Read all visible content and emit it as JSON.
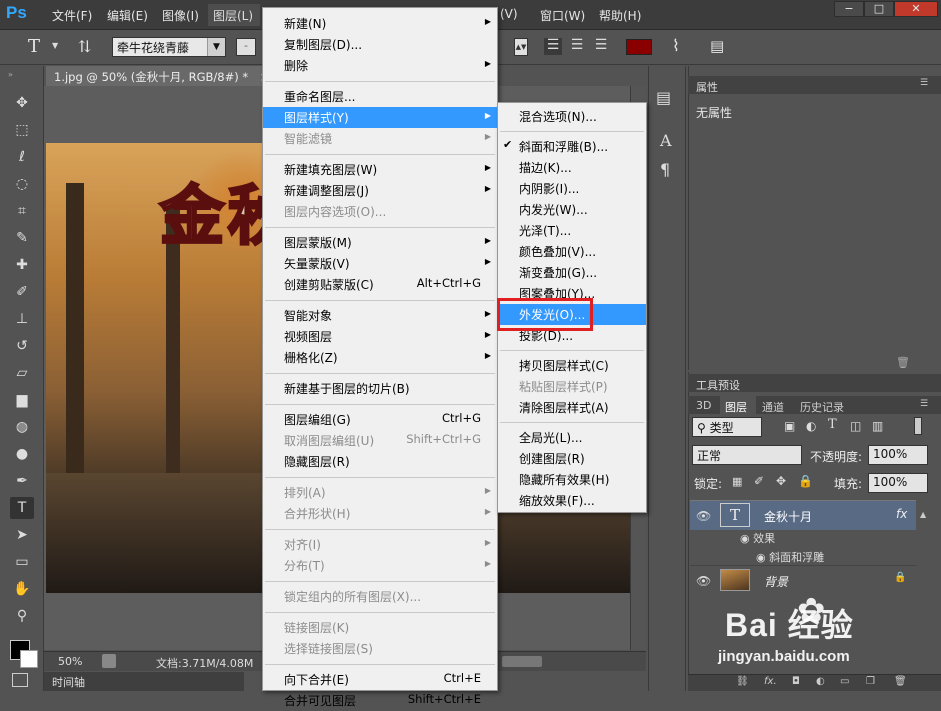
{
  "app": {
    "logo": "Ps"
  },
  "menubar": {
    "items": [
      "文件(F)",
      "编辑(E)",
      "图像(I)",
      "图层(L)",
      "(V)",
      "窗口(W)",
      "帮助(H)"
    ],
    "window_buttons": [
      "−",
      "□",
      "✕"
    ]
  },
  "options": {
    "tool_glyph": "T",
    "font_family": "牵牛花绕青藤",
    "dash": "-",
    "accent_color": "#8a0000"
  },
  "tools": [
    {
      "icon": "move-icon",
      "glyph": "✥"
    },
    {
      "icon": "marquee-icon",
      "glyph": "⬚"
    },
    {
      "icon": "lasso-icon",
      "glyph": "ℓ"
    },
    {
      "icon": "quick-select-icon",
      "glyph": "◌"
    },
    {
      "icon": "crop-icon",
      "glyph": "⌗"
    },
    {
      "icon": "eyedropper-icon",
      "glyph": "✎"
    },
    {
      "icon": "healing-icon",
      "glyph": "✚"
    },
    {
      "icon": "brush-icon",
      "glyph": "✐"
    },
    {
      "icon": "stamp-icon",
      "glyph": "⊥"
    },
    {
      "icon": "history-brush-icon",
      "glyph": "↺"
    },
    {
      "icon": "eraser-icon",
      "glyph": "▱"
    },
    {
      "icon": "gradient-icon",
      "glyph": "▆"
    },
    {
      "icon": "blur-icon",
      "glyph": "◍"
    },
    {
      "icon": "dodge-icon",
      "glyph": "●"
    },
    {
      "icon": "pen-icon",
      "glyph": "✒"
    },
    {
      "icon": "type-icon",
      "glyph": "T"
    },
    {
      "icon": "path-select-icon",
      "glyph": "➤"
    },
    {
      "icon": "rectangle-icon",
      "glyph": "▭"
    },
    {
      "icon": "hand-icon",
      "glyph": "✋"
    },
    {
      "icon": "zoom-icon",
      "glyph": "⚲"
    }
  ],
  "document": {
    "tab_title": "1.jpg @ 50% (金秋十月, RGB/8#) *",
    "tab_close": "×",
    "canvas_text": "金秋",
    "zoom": "50%",
    "doc_size": "文档:3.71M/4.08M"
  },
  "timeline": {
    "label": "时间轴"
  },
  "properties": {
    "title": "属性",
    "body": "无属性"
  },
  "panels": {
    "tool_presets": "工具预设",
    "tabs": [
      "3D",
      "图层",
      "通道",
      "历史记录"
    ]
  },
  "layers": {
    "filter_label": "类型",
    "blend_mode": "正常",
    "opacity_label": "不透明度:",
    "opacity_value": "100%",
    "lock_label": "锁定:",
    "fill_label": "填充:",
    "fill_value": "100%",
    "text_layer": {
      "name": "金秋十月",
      "fx": "fx",
      "thumb": "T"
    },
    "effects_label": "效果",
    "effect_item": "斜面和浮雕",
    "bg_layer": {
      "name": "背景"
    }
  },
  "watermark": {
    "logo": "Bai  经验",
    "url": "jingyan.baidu.com"
  },
  "main_menu": {
    "items": [
      {
        "label": "新建(N)",
        "sub": true
      },
      {
        "label": "复制图层(D)..."
      },
      {
        "label": "删除",
        "sub": true
      },
      {
        "sep": true
      },
      {
        "label": "重命名图层..."
      },
      {
        "label": "图层样式(Y)",
        "sub": true,
        "highlight": true
      },
      {
        "label": "智能滤镜",
        "disabled": true,
        "sub": true
      },
      {
        "sep": true
      },
      {
        "label": "新建填充图层(W)",
        "sub": true
      },
      {
        "label": "新建调整图层(J)",
        "sub": true
      },
      {
        "label": "图层内容选项(O)...",
        "disabled": true
      },
      {
        "sep": true
      },
      {
        "label": "图层蒙版(M)",
        "sub": true
      },
      {
        "label": "矢量蒙版(V)",
        "sub": true
      },
      {
        "label": "创建剪贴蒙版(C)",
        "shortcut": "Alt+Ctrl+G"
      },
      {
        "sep": true
      },
      {
        "label": "智能对象",
        "sub": true
      },
      {
        "label": "视频图层",
        "sub": true
      },
      {
        "label": "栅格化(Z)",
        "sub": true
      },
      {
        "sep": true
      },
      {
        "label": "新建基于图层的切片(B)"
      },
      {
        "sep": true
      },
      {
        "label": "图层编组(G)",
        "shortcut": "Ctrl+G"
      },
      {
        "label": "取消图层编组(U)",
        "shortcut": "Shift+Ctrl+G",
        "disabled": true
      },
      {
        "label": "隐藏图层(R)"
      },
      {
        "sep": true
      },
      {
        "label": "排列(A)",
        "sub": true,
        "disabled": true
      },
      {
        "label": "合并形状(H)",
        "sub": true,
        "disabled": true
      },
      {
        "sep": true
      },
      {
        "label": "对齐(I)",
        "sub": true,
        "disabled": true
      },
      {
        "label": "分布(T)",
        "sub": true,
        "disabled": true
      },
      {
        "sep": true
      },
      {
        "label": "锁定组内的所有图层(X)...",
        "disabled": true
      },
      {
        "sep": true
      },
      {
        "label": "链接图层(K)",
        "disabled": true
      },
      {
        "label": "选择链接图层(S)",
        "disabled": true
      },
      {
        "sep": true
      },
      {
        "label": "向下合并(E)",
        "shortcut": "Ctrl+E"
      },
      {
        "label": "合并可见图层",
        "shortcut": "Shift+Ctrl+E"
      }
    ]
  },
  "sub_menu": {
    "items": [
      {
        "label": "混合选项(N)..."
      },
      {
        "sep": true
      },
      {
        "label": "斜面和浮雕(B)...",
        "checked": true
      },
      {
        "label": "描边(K)..."
      },
      {
        "label": "内阴影(I)..."
      },
      {
        "label": "内发光(W)..."
      },
      {
        "label": "光泽(T)..."
      },
      {
        "label": "颜色叠加(V)..."
      },
      {
        "label": "渐变叠加(G)..."
      },
      {
        "label": "图案叠加(Y)..."
      },
      {
        "label": "外发光(O)...",
        "highlight": true
      },
      {
        "label": "投影(D)..."
      },
      {
        "sep": true
      },
      {
        "label": "拷贝图层样式(C)"
      },
      {
        "label": "粘贴图层样式(P)",
        "disabled": true
      },
      {
        "label": "清除图层样式(A)"
      },
      {
        "sep": true
      },
      {
        "label": "全局光(L)..."
      },
      {
        "label": "创建图层(R)"
      },
      {
        "label": "隐藏所有效果(H)"
      },
      {
        "label": "缩放效果(F)..."
      }
    ]
  }
}
